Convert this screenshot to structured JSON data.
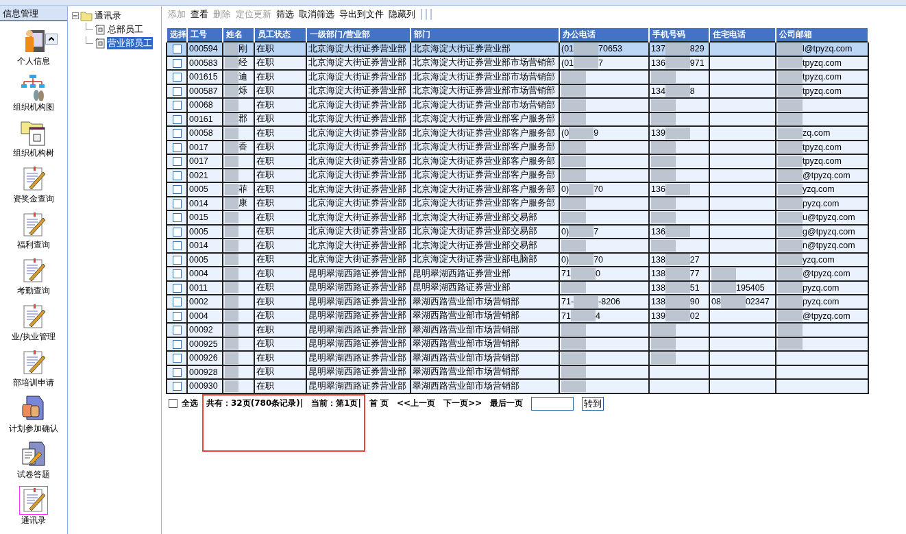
{
  "sidebar": {
    "title": "信息管理",
    "items": [
      {
        "label": "个人信息",
        "kind": "person",
        "selected": false
      },
      {
        "label": "组织机构图",
        "kind": "org",
        "selected": false
      },
      {
        "label": "组织机构树",
        "kind": "folder",
        "selected": false
      },
      {
        "label": "资奖金查询",
        "kind": "note",
        "selected": false
      },
      {
        "label": "福利查询",
        "kind": "note",
        "selected": false
      },
      {
        "label": "考勤查询",
        "kind": "note",
        "selected": false
      },
      {
        "label": "业/执业管理",
        "kind": "note",
        "selected": false
      },
      {
        "label": "部培训申请",
        "kind": "note",
        "selected": false
      },
      {
        "label": "计划参加确认",
        "kind": "people",
        "selected": false
      },
      {
        "label": "试卷答题",
        "kind": "exam",
        "selected": false
      },
      {
        "label": "通讯录",
        "kind": "note",
        "selected": true
      }
    ]
  },
  "tree": {
    "label": "通讯录",
    "expanded": true,
    "children": [
      {
        "label": "总部员工",
        "selected": false
      },
      {
        "label": "营业部员工",
        "selected": true
      }
    ]
  },
  "toolbar": [
    {
      "label": "添加",
      "disabled": true
    },
    {
      "label": "查看",
      "disabled": false
    },
    {
      "label": "删除",
      "disabled": true
    },
    {
      "label": "定位更新",
      "disabled": true
    },
    {
      "label": "筛选",
      "disabled": false
    },
    {
      "label": "取消筛选",
      "disabled": false
    },
    {
      "label": "导出到文件",
      "disabled": false
    },
    {
      "label": "隐藏列",
      "disabled": false
    }
  ],
  "table": {
    "columns": [
      "选择",
      "工号",
      "姓名",
      "员工状态",
      "一级部门/营业部",
      "部门",
      "办公电话",
      "手机号码",
      "住宅电话",
      "公司邮箱"
    ],
    "rows": [
      {
        "id": "000594",
        "name": {
          "redacted": true,
          "post": "刚"
        },
        "status": "在职",
        "branch": "北京海淀大街证券营业部",
        "dept": "北京海淀大街证券营业部",
        "office": {
          "redacted": true,
          "pre": "(01",
          "post": "70653"
        },
        "mobile": {
          "redacted": true,
          "pre": "137",
          "post": "829"
        },
        "home": {
          "redacted": false
        },
        "email": {
          "redacted": true,
          "post": "l@tpyzq.com"
        },
        "checked": false,
        "selected": true
      },
      {
        "id": "000583",
        "name": {
          "redacted": true,
          "post": "经"
        },
        "status": "在职",
        "branch": "北京海淀大街证券营业部",
        "dept": "北京海淀大街证券营业部市场营销部",
        "office": {
          "redacted": true,
          "pre": "(01",
          "post": "7"
        },
        "mobile": {
          "redacted": true,
          "pre": "136",
          "post": "971"
        },
        "home": {
          "redacted": false
        },
        "email": {
          "redacted": true,
          "post": "tpyzq.com"
        },
        "checked": false,
        "selected": false
      },
      {
        "id": "001615",
        "name": {
          "redacted": true,
          "post": "迪"
        },
        "status": "在职",
        "branch": "北京海淀大街证券营业部",
        "dept": "北京海淀大街证券营业部市场营销部",
        "office": {
          "redacted": true
        },
        "mobile": {
          "redacted": true
        },
        "home": {
          "redacted": false
        },
        "email": {
          "redacted": true,
          "post": "tpyzq.com"
        },
        "checked": false,
        "selected": false
      },
      {
        "id": "000587",
        "name": {
          "redacted": true,
          "post": "烁"
        },
        "status": "在职",
        "branch": "北京海淀大街证券营业部",
        "dept": "北京海淀大街证券营业部市场营销部",
        "office": {
          "redacted": true
        },
        "mobile": {
          "redacted": true,
          "pre": "134",
          "post": "8"
        },
        "home": {
          "redacted": false
        },
        "email": {
          "redacted": true,
          "post": "tpyzq.com"
        },
        "checked": false,
        "selected": false
      },
      {
        "id": "00068",
        "name": {
          "redacted": true
        },
        "status": "在职",
        "branch": "北京海淀大街证券营业部",
        "dept": "北京海淀大街证券营业部市场营销部",
        "office": {
          "redacted": true
        },
        "mobile": {
          "redacted": true
        },
        "home": {
          "redacted": false
        },
        "email": {
          "redacted": true
        },
        "checked": false,
        "selected": false
      },
      {
        "id": "00161",
        "name": {
          "redacted": true,
          "post": "郡"
        },
        "status": "在职",
        "branch": "北京海淀大街证券营业部",
        "dept": "北京海淀大街证券营业部客户服务部",
        "office": {
          "redacted": true
        },
        "mobile": {
          "redacted": true
        },
        "home": {
          "redacted": false
        },
        "email": {
          "redacted": true
        },
        "checked": false,
        "selected": false
      },
      {
        "id": "00058",
        "name": {
          "redacted": true
        },
        "status": "在职",
        "branch": "北京海淀大街证券营业部",
        "dept": "北京海淀大街证券营业部客户服务部",
        "office": {
          "redacted": true,
          "pre": "(0",
          "post": "9"
        },
        "mobile": {
          "redacted": true,
          "pre": "139"
        },
        "home": {
          "redacted": false
        },
        "email": {
          "redacted": true,
          "post": "zq.com"
        },
        "checked": false,
        "selected": false
      },
      {
        "id": "0017",
        "name": {
          "redacted": true,
          "post": "香"
        },
        "status": "在职",
        "branch": "北京海淀大街证券营业部",
        "dept": "北京海淀大街证券营业部客户服务部",
        "office": {
          "redacted": true
        },
        "mobile": {
          "redacted": true
        },
        "home": {
          "redacted": false
        },
        "email": {
          "redacted": true,
          "post": "tpyzq.com"
        },
        "checked": false,
        "selected": false
      },
      {
        "id": "0017",
        "name": {
          "redacted": true
        },
        "status": "在职",
        "branch": "北京海淀大街证券营业部",
        "dept": "北京海淀大街证券营业部客户服务部",
        "office": {
          "redacted": true
        },
        "mobile": {
          "redacted": true
        },
        "home": {
          "redacted": false
        },
        "email": {
          "redacted": true,
          "post": "tpyzq.com"
        },
        "checked": false,
        "selected": false
      },
      {
        "id": "0021",
        "name": {
          "redacted": true
        },
        "status": "在职",
        "branch": "北京海淀大街证券营业部",
        "dept": "北京海淀大街证券营业部客户服务部",
        "office": {
          "redacted": true
        },
        "mobile": {
          "redacted": true
        },
        "home": {
          "redacted": false
        },
        "email": {
          "redacted": true,
          "post": "@tpyzq.com"
        },
        "checked": false,
        "selected": false
      },
      {
        "id": "0005",
        "name": {
          "redacted": true,
          "post": "菲"
        },
        "status": "在职",
        "branch": "北京海淀大街证券营业部",
        "dept": "北京海淀大街证券营业部客户服务部",
        "office": {
          "redacted": true,
          "pre": "0)",
          "post": "70"
        },
        "mobile": {
          "redacted": true,
          "pre": "136"
        },
        "home": {
          "redacted": false
        },
        "email": {
          "redacted": true,
          "post": "yzq.com"
        },
        "checked": false,
        "selected": false
      },
      {
        "id": "0014",
        "name": {
          "redacted": true,
          "post": "康"
        },
        "status": "在职",
        "branch": "北京海淀大街证券营业部",
        "dept": "北京海淀大街证券营业部客户服务部",
        "office": {
          "redacted": true
        },
        "mobile": {
          "redacted": true
        },
        "home": {
          "redacted": false
        },
        "email": {
          "redacted": true,
          "post": "pyzq.com"
        },
        "checked": false,
        "selected": false
      },
      {
        "id": "0015",
        "name": {
          "redacted": true
        },
        "status": "在职",
        "branch": "北京海淀大街证券营业部",
        "dept": "北京海淀大街证券营业部交易部",
        "office": {
          "redacted": true
        },
        "mobile": {
          "redacted": true
        },
        "home": {
          "redacted": false
        },
        "email": {
          "redacted": true,
          "post": "u@tpyzq.com"
        },
        "checked": false,
        "selected": false
      },
      {
        "id": "0005",
        "name": {
          "redacted": true
        },
        "status": "在职",
        "branch": "北京海淀大街证券营业部",
        "dept": "北京海淀大街证券营业部交易部",
        "office": {
          "redacted": true,
          "pre": "0)",
          "post": "7"
        },
        "mobile": {
          "redacted": true,
          "pre": "136"
        },
        "home": {
          "redacted": false
        },
        "email": {
          "redacted": true,
          "post": "g@tpyzq.com"
        },
        "checked": false,
        "selected": false
      },
      {
        "id": "0014",
        "name": {
          "redacted": true
        },
        "status": "在职",
        "branch": "北京海淀大街证券营业部",
        "dept": "北京海淀大街证券营业部交易部",
        "office": {
          "redacted": true
        },
        "mobile": {
          "redacted": true
        },
        "home": {
          "redacted": false
        },
        "email": {
          "redacted": true,
          "post": "n@tpyzq.com"
        },
        "checked": false,
        "selected": false
      },
      {
        "id": "0005",
        "name": {
          "redacted": true
        },
        "status": "在职",
        "branch": "北京海淀大街证券营业部",
        "dept": "北京海淀大街证券营业部电脑部",
        "office": {
          "redacted": true,
          "pre": "0)",
          "post": "70"
        },
        "mobile": {
          "redacted": true,
          "pre": "138",
          "post": "27"
        },
        "home": {
          "redacted": false
        },
        "email": {
          "redacted": true,
          "post": "yzq.com"
        },
        "checked": false,
        "selected": false
      },
      {
        "id": "0004",
        "name": {
          "redacted": true
        },
        "status": "在职",
        "branch": "昆明翠湖西路证券营业部",
        "dept": "昆明翠湖西路证券营业部",
        "office": {
          "redacted": true,
          "pre": "71",
          "post": "0"
        },
        "mobile": {
          "redacted": true,
          "pre": "138",
          "post": "77"
        },
        "home": {
          "redacted": true
        },
        "email": {
          "redacted": true,
          "post": "@tpyzq.com"
        },
        "checked": false,
        "selected": false
      },
      {
        "id": "0011",
        "name": {
          "redacted": true
        },
        "status": "在职",
        "branch": "昆明翠湖西路证券营业部",
        "dept": "昆明翠湖西路证券营业部",
        "office": {
          "redacted": true
        },
        "mobile": {
          "redacted": true,
          "pre": "138",
          "post": "51"
        },
        "home": {
          "redacted": true,
          "post": "195405"
        },
        "email": {
          "redacted": true,
          "post": "pyzq.com"
        },
        "checked": false,
        "selected": false
      },
      {
        "id": "0002",
        "name": {
          "redacted": true
        },
        "status": "在职",
        "branch": "昆明翠湖西路证券营业部",
        "dept": "翠湖西路营业部市场营销部",
        "office": {
          "redacted": true,
          "pre": "71-",
          "post": "-8206"
        },
        "mobile": {
          "redacted": true,
          "pre": "138",
          "post": "90"
        },
        "home": {
          "redacted": true,
          "pre": "08",
          "post": "02347"
        },
        "email": {
          "redacted": true,
          "post": "pyzq.com"
        },
        "checked": false,
        "selected": false
      },
      {
        "id": "0004",
        "name": {
          "redacted": true
        },
        "status": "在职",
        "branch": "昆明翠湖西路证券营业部",
        "dept": "翠湖西路营业部市场营销部",
        "office": {
          "redacted": true,
          "pre": "71",
          "post": "4"
        },
        "mobile": {
          "redacted": true,
          "pre": "139",
          "post": "02"
        },
        "home": {
          "redacted": false
        },
        "email": {
          "redacted": true,
          "post": "@tpyzq.com"
        },
        "checked": false,
        "selected": false
      },
      {
        "id": "00092",
        "name": {
          "redacted": true
        },
        "status": "在职",
        "branch": "昆明翠湖西路证券营业部",
        "dept": "翠湖西路营业部市场营销部",
        "office": {
          "redacted": true
        },
        "mobile": {
          "redacted": true
        },
        "home": {
          "redacted": false
        },
        "email": {
          "redacted": true
        },
        "checked": false,
        "selected": false
      },
      {
        "id": "000925",
        "name": {
          "redacted": true
        },
        "status": "在职",
        "branch": "昆明翠湖西路证券营业部",
        "dept": "翠湖西路营业部市场营销部",
        "office": {
          "redacted": true
        },
        "mobile": {
          "redacted": true
        },
        "home": {
          "redacted": false
        },
        "email": {
          "redacted": true
        },
        "checked": false,
        "selected": false
      },
      {
        "id": "000926",
        "name": {
          "redacted": true
        },
        "status": "在职",
        "branch": "昆明翠湖西路证券营业部",
        "dept": "翠湖西路营业部市场营销部",
        "office": {
          "redacted": true
        },
        "mobile": {
          "redacted": true
        },
        "home": {
          "redacted": false
        },
        "email": {
          "redacted": false
        },
        "checked": false,
        "selected": false
      },
      {
        "id": "000928",
        "name": {
          "redacted": true
        },
        "status": "在职",
        "branch": "昆明翠湖西路证券营业部",
        "dept": "翠湖西路营业部市场营销部",
        "office": {
          "redacted": true
        },
        "mobile": {
          "redacted": false
        },
        "home": {
          "redacted": false
        },
        "email": {
          "redacted": false
        },
        "checked": false,
        "selected": false
      },
      {
        "id": "000930",
        "name": {
          "redacted": true
        },
        "status": "在职",
        "branch": "昆明翠湖西路证券营业部",
        "dept": "翠湖西路营业部市场营销部",
        "office": {
          "redacted": true
        },
        "mobile": {
          "redacted": false
        },
        "home": {
          "redacted": false
        },
        "email": {
          "redacted": false
        },
        "checked": false,
        "selected": false
      }
    ]
  },
  "pager": {
    "select_all": {
      "label": "全选",
      "checked": false
    },
    "total": "共有：32页(780条记录)|",
    "current": "当前：第1页|",
    "first": "首 页",
    "prev": "<<上一页",
    "next": "下一页>>",
    "last": "最后一页",
    "go": "转到"
  },
  "highlight_frame": true
}
